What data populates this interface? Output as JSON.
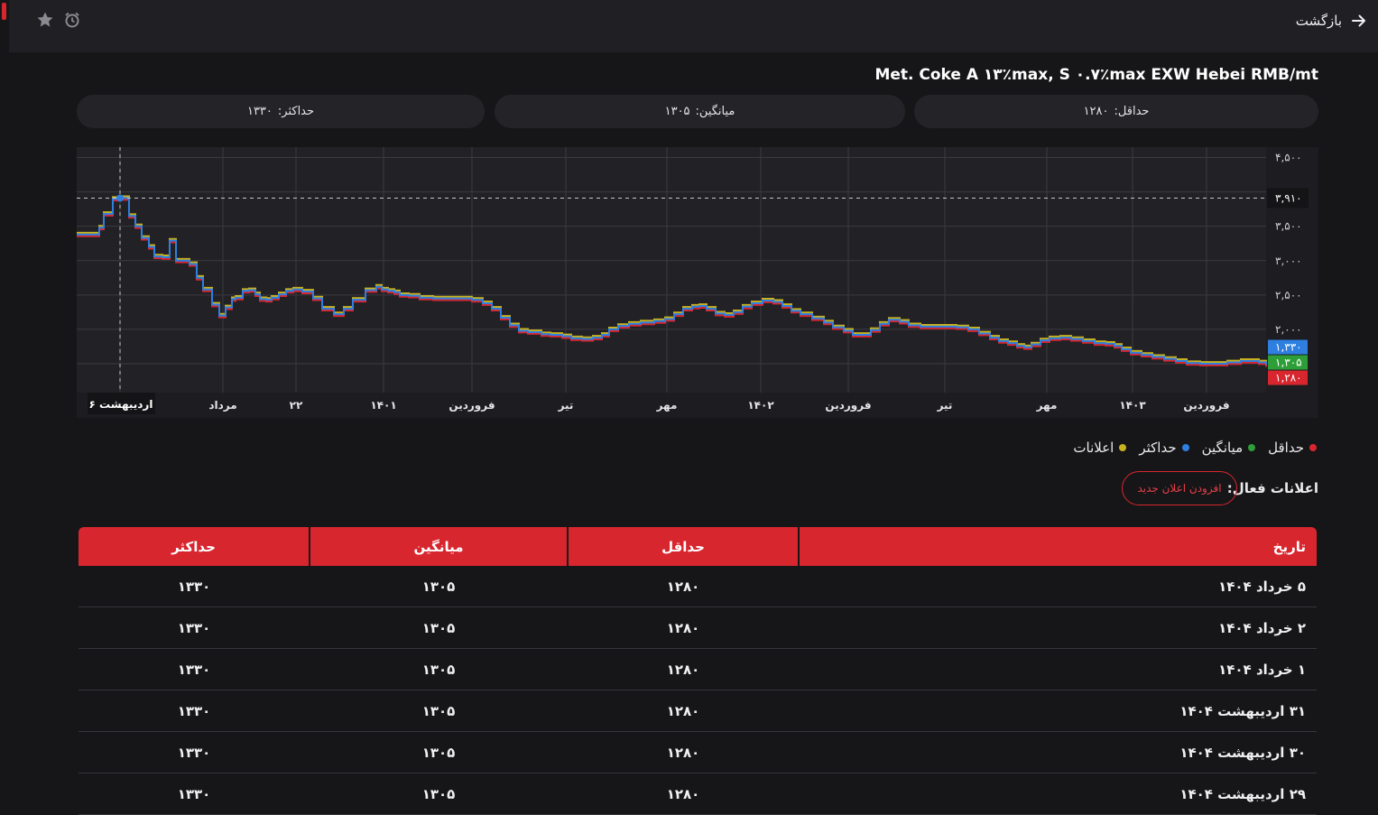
{
  "header": {
    "back_label": "بازگشت",
    "icons": [
      "arrow-right-icon",
      "star-icon",
      "alarm-icon"
    ]
  },
  "title": "Met. Coke A ۱۳٪max, S ۰.۷٪max EXW Hebei RMB/mt",
  "stats": {
    "min_label": "حداقل:",
    "min_value": "۱۲۸۰",
    "avg_label": "میانگین:",
    "avg_value": "۱۳۰۵",
    "max_label": "حداکثر:",
    "max_value": "۱۳۳۰"
  },
  "chart_data": {
    "type": "line",
    "y_ticks": [
      "۴,۵۰۰",
      "۳,۵۰۰",
      "۳,۰۰۰",
      "۲,۵۰۰",
      "۲,۰۰۰"
    ],
    "ylim": [
      1050,
      4600
    ],
    "x_ticks": [
      "اردیبهشت ۶",
      "مرداد",
      "۲۲",
      "۱۴۰۱",
      "فروردین",
      "تیر",
      "مهر",
      "۱۴۰۲",
      "فروردین",
      "تیر",
      "مهر",
      "۱۴۰۳",
      "فروردین"
    ],
    "crosshair": {
      "label": "اردیبهشت ۶",
      "value_label": "۳,۹۱۰",
      "value": 3910
    },
    "last_badges": {
      "max": "۱,۳۳۰",
      "avg": "۱,۳۰۵",
      "min": "۱,۲۸۰"
    },
    "colors": {
      "min": "#d8262f",
      "avg": "#2f7fe0",
      "max": "#c9b21f",
      "avg_badge": "#2e9f38"
    },
    "series": [
      {
        "name": "حداقل",
        "offset": -25
      },
      {
        "name": "میانگین",
        "offset": 0
      },
      {
        "name": "حداکثر",
        "offset": 25
      }
    ],
    "points": [
      [
        0,
        3380
      ],
      [
        25,
        3480
      ],
      [
        30,
        3680
      ],
      [
        40,
        3900
      ],
      [
        48,
        3910
      ],
      [
        58,
        3650
      ],
      [
        65,
        3500
      ],
      [
        72,
        3330
      ],
      [
        80,
        3200
      ],
      [
        86,
        3060
      ],
      [
        95,
        3050
      ],
      [
        103,
        3290
      ],
      [
        110,
        3000
      ],
      [
        125,
        2950
      ],
      [
        133,
        2750
      ],
      [
        140,
        2580
      ],
      [
        150,
        2360
      ],
      [
        158,
        2200
      ],
      [
        165,
        2320
      ],
      [
        172,
        2440
      ],
      [
        176,
        2460
      ],
      [
        184,
        2560
      ],
      [
        191,
        2570
      ],
      [
        198,
        2510
      ],
      [
        203,
        2440
      ],
      [
        210,
        2430
      ],
      [
        216,
        2460
      ],
      [
        224,
        2510
      ],
      [
        232,
        2560
      ],
      [
        240,
        2580
      ],
      [
        250,
        2550
      ],
      [
        262,
        2450
      ],
      [
        272,
        2300
      ],
      [
        285,
        2220
      ],
      [
        296,
        2300
      ],
      [
        306,
        2430
      ],
      [
        320,
        2570
      ],
      [
        332,
        2620
      ],
      [
        338,
        2580
      ],
      [
        345,
        2560
      ],
      [
        352,
        2540
      ],
      [
        358,
        2500
      ],
      [
        368,
        2490
      ],
      [
        380,
        2460
      ],
      [
        395,
        2450
      ],
      [
        410,
        2450
      ],
      [
        425,
        2450
      ],
      [
        438,
        2430
      ],
      [
        450,
        2380
      ],
      [
        460,
        2300
      ],
      [
        470,
        2170
      ],
      [
        480,
        2060
      ],
      [
        490,
        1980
      ],
      [
        500,
        1960
      ],
      [
        515,
        1930
      ],
      [
        525,
        1920
      ],
      [
        538,
        1900
      ],
      [
        548,
        1870
      ],
      [
        560,
        1860
      ],
      [
        572,
        1880
      ],
      [
        582,
        1920
      ],
      [
        590,
        2000
      ],
      [
        600,
        2050
      ],
      [
        612,
        2080
      ],
      [
        625,
        2100
      ],
      [
        640,
        2120
      ],
      [
        652,
        2150
      ],
      [
        662,
        2220
      ],
      [
        672,
        2300
      ],
      [
        682,
        2330
      ],
      [
        690,
        2340
      ],
      [
        698,
        2300
      ],
      [
        708,
        2230
      ],
      [
        718,
        2210
      ],
      [
        728,
        2250
      ],
      [
        738,
        2330
      ],
      [
        748,
        2380
      ],
      [
        760,
        2420
      ],
      [
        772,
        2400
      ],
      [
        782,
        2340
      ],
      [
        792,
        2270
      ],
      [
        802,
        2220
      ],
      [
        815,
        2160
      ],
      [
        828,
        2100
      ],
      [
        838,
        2030
      ],
      [
        850,
        1980
      ],
      [
        860,
        1920
      ],
      [
        870,
        1920
      ],
      [
        880,
        1990
      ],
      [
        890,
        2080
      ],
      [
        900,
        2140
      ],
      [
        912,
        2110
      ],
      [
        922,
        2060
      ],
      [
        935,
        2040
      ],
      [
        948,
        2040
      ],
      [
        962,
        2040
      ],
      [
        975,
        2030
      ],
      [
        988,
        2000
      ],
      [
        1000,
        1940
      ],
      [
        1012,
        1880
      ],
      [
        1022,
        1830
      ],
      [
        1032,
        1800
      ],
      [
        1042,
        1760
      ],
      [
        1050,
        1740
      ],
      [
        1058,
        1780
      ],
      [
        1068,
        1840
      ],
      [
        1078,
        1870
      ],
      [
        1090,
        1880
      ],
      [
        1102,
        1860
      ],
      [
        1115,
        1830
      ],
      [
        1128,
        1800
      ],
      [
        1140,
        1790
      ],
      [
        1150,
        1760
      ],
      [
        1158,
        1710
      ],
      [
        1168,
        1660
      ],
      [
        1180,
        1630
      ],
      [
        1192,
        1600
      ],
      [
        1205,
        1570
      ],
      [
        1218,
        1540
      ],
      [
        1230,
        1510
      ],
      [
        1245,
        1500
      ],
      [
        1260,
        1500
      ],
      [
        1275,
        1520
      ],
      [
        1290,
        1540
      ],
      [
        1300,
        1540
      ],
      [
        1310,
        1520
      ],
      [
        1318,
        1480
      ]
    ]
  },
  "legend": [
    {
      "label": "حداقل",
      "color": "#d8262f"
    },
    {
      "label": "میانگین",
      "color": "#2e9f38"
    },
    {
      "label": "حداکثر",
      "color": "#2f7fe0"
    },
    {
      "label": "اعلانات",
      "color": "#c9b21f"
    }
  ],
  "alerts": {
    "label": "اعلانات فعال:",
    "add_button": "افزودن اعلان جدید"
  },
  "table": {
    "headers": [
      "تاریخ",
      "حداقل",
      "میانگین",
      "حداکثر"
    ],
    "rows": [
      [
        "۵ خرداد ۱۴۰۴",
        "۱۲۸۰",
        "۱۳۰۵",
        "۱۳۳۰"
      ],
      [
        "۲ خرداد ۱۴۰۴",
        "۱۲۸۰",
        "۱۳۰۵",
        "۱۳۳۰"
      ],
      [
        "۱ خرداد ۱۴۰۴",
        "۱۲۸۰",
        "۱۳۰۵",
        "۱۳۳۰"
      ],
      [
        "۳۱ اردیبهشت ۱۴۰۴",
        "۱۲۸۰",
        "۱۳۰۵",
        "۱۳۳۰"
      ],
      [
        "۳۰ اردیبهشت ۱۴۰۴",
        "۱۲۸۰",
        "۱۳۰۵",
        "۱۳۳۰"
      ],
      [
        "۲۹ اردیبهشت ۱۴۰۴",
        "۱۲۸۰",
        "۱۳۰۵",
        "۱۳۳۰"
      ]
    ]
  }
}
